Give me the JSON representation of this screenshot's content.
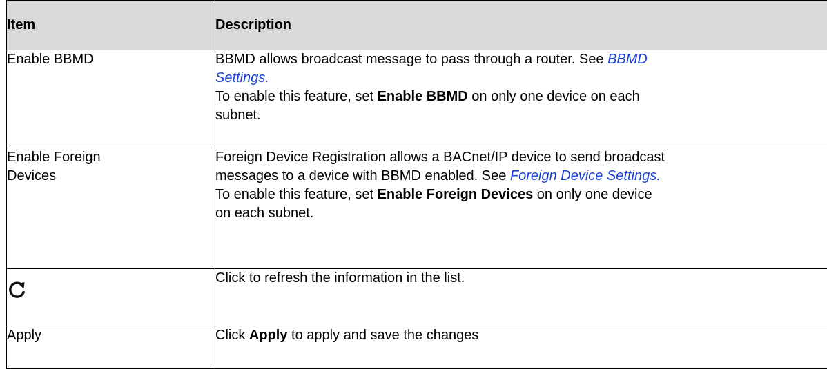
{
  "table": {
    "headers": {
      "item": "Item",
      "description": "Description"
    },
    "rows": {
      "bbmd": {
        "item": "Enable BBMD",
        "desc_line1_pre": "BBMD allows broadcast message to pass through a router. See ",
        "desc_link_a": "BBMD",
        "desc_link_b": "Settings.",
        "desc_line2_pre": "To enable this feature, set ",
        "desc_bold": "Enable BBMD",
        "desc_line2_post": " on only one device on each",
        "desc_line3": "subnet."
      },
      "foreign": {
        "item_line1": "Enable Foreign",
        "item_line2": "Devices",
        "desc_line1": "Foreign Device Registration allows a BACnet/IP device to send broadcast",
        "desc_line2_pre": "messages to a device with BBMD enabled. See ",
        "desc_link": "Foreign Device Settings.",
        "desc_line3_pre": "To enable this feature, set ",
        "desc_bold": "Enable Foreign Devices",
        "desc_line3_post": " on only one device",
        "desc_line4": "on each subnet."
      },
      "refresh": {
        "icon": "refresh-icon",
        "description": "Click to refresh the information in the list."
      },
      "apply": {
        "item": "Apply",
        "desc_pre": "Click ",
        "desc_bold": "Apply",
        "desc_post": " to apply and save the changes"
      }
    },
    "colors": {
      "header_bg": "#d9d9d9",
      "link": "#1a3fd6",
      "border": "#000000"
    }
  }
}
